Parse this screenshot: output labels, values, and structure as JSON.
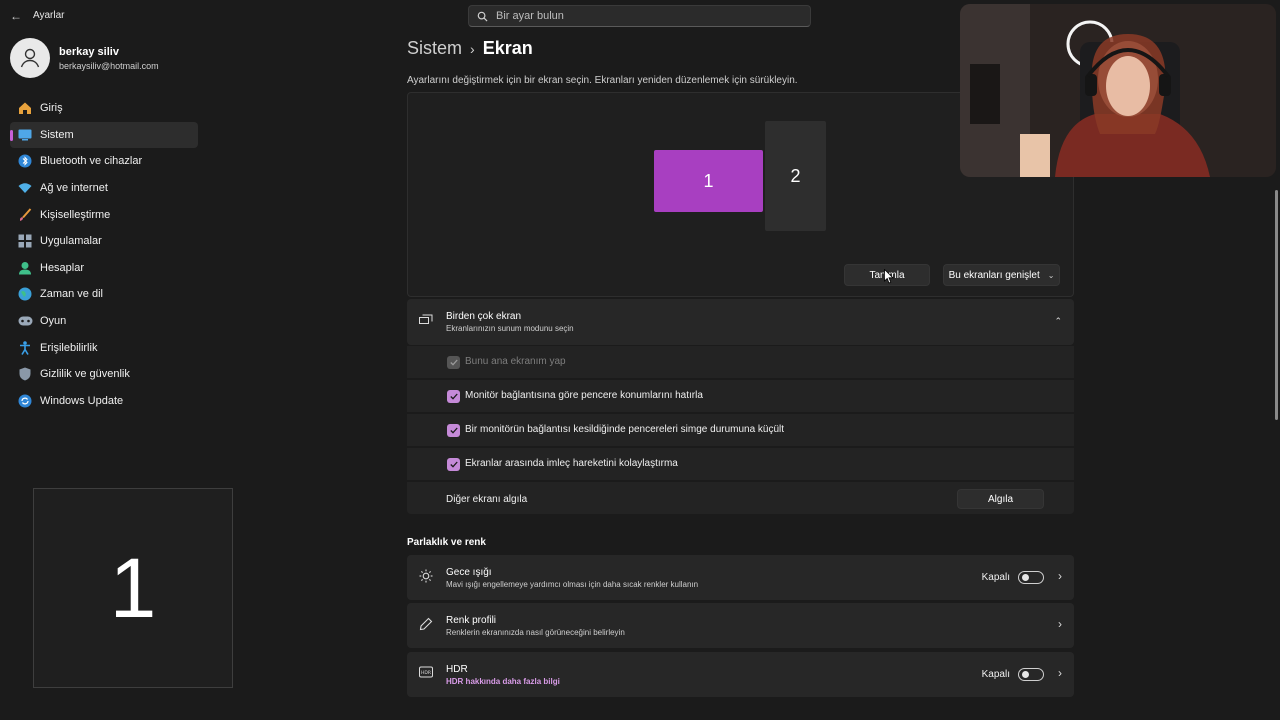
{
  "app": {
    "title": "Ayarlar"
  },
  "search": {
    "placeholder": "Bir ayar bulun"
  },
  "profile": {
    "name": "berkay siliv",
    "email": "berkaysiliv@hotmail.com"
  },
  "sidebar": {
    "items": [
      {
        "label": "Giriş",
        "icon": "home-icon",
        "active": false
      },
      {
        "label": "Sistem",
        "icon": "system-icon",
        "active": true
      },
      {
        "label": "Bluetooth ve cihazlar",
        "icon": "bluetooth-icon",
        "active": false
      },
      {
        "label": "Ağ ve internet",
        "icon": "network-icon",
        "active": false
      },
      {
        "label": "Kişiselleştirme",
        "icon": "brush-icon",
        "active": false
      },
      {
        "label": "Uygulamalar",
        "icon": "apps-icon",
        "active": false
      },
      {
        "label": "Hesaplar",
        "icon": "account-icon",
        "active": false
      },
      {
        "label": "Zaman ve dil",
        "icon": "globe-icon",
        "active": false
      },
      {
        "label": "Oyun",
        "icon": "gamepad-icon",
        "active": false
      },
      {
        "label": "Erişilebilirlik",
        "icon": "accessibility-icon",
        "active": false
      },
      {
        "label": "Gizlilik ve güvenlik",
        "icon": "shield-icon",
        "active": false
      },
      {
        "label": "Windows Update",
        "icon": "update-icon",
        "active": false
      }
    ]
  },
  "identify_overlay": {
    "number": "1"
  },
  "breadcrumb": {
    "parent": "Sistem",
    "current": "Ekran"
  },
  "arrange": {
    "hint": "Ayarlarını değiştirmek için bir ekran seçin. Ekranları yeniden düzenlemek için sürükleyin.",
    "monitors": [
      "1",
      "2"
    ],
    "identify_label": "Tanımla",
    "extend_label": "Bu ekranları genişlet"
  },
  "multi_display": {
    "title": "Birden çok ekran",
    "subtitle": "Ekranlarınızın sunum modunu seçin",
    "options": [
      {
        "label": "Bunu ana ekranım yap",
        "checked": true,
        "disabled": true
      },
      {
        "label": "Monitör bağlantısına göre pencere konumlarını hatırla",
        "checked": true,
        "disabled": false
      },
      {
        "label": "Bir monitörün bağlantısı kesildiğinde pencereleri simge durumuna küçült",
        "checked": true,
        "disabled": false
      },
      {
        "label": "Ekranlar arasında imleç hareketini kolaylaştırma",
        "checked": true,
        "disabled": false
      }
    ],
    "detect_label": "Diğer ekranı algıla",
    "detect_button": "Algıla"
  },
  "brightness": {
    "title": "Parlaklık ve renk",
    "night_light": {
      "title": "Gece ışığı",
      "subtitle": "Mavi ışığı engellemeye yardımcı olması için daha sıcak renkler kullanın",
      "state": "Kapalı"
    },
    "color_profile": {
      "title": "Renk profili",
      "subtitle": "Renklerin ekranınızda nasıl görüneceğini belirleyin"
    },
    "hdr": {
      "title": "HDR",
      "link": "HDR hakkında daha fazla bilgi",
      "state": "Kapalı"
    }
  },
  "colors": {
    "accent": "#a83fc1",
    "checkbox": "#c58ad8",
    "background": "#1b1b1b",
    "card": "#272727"
  }
}
